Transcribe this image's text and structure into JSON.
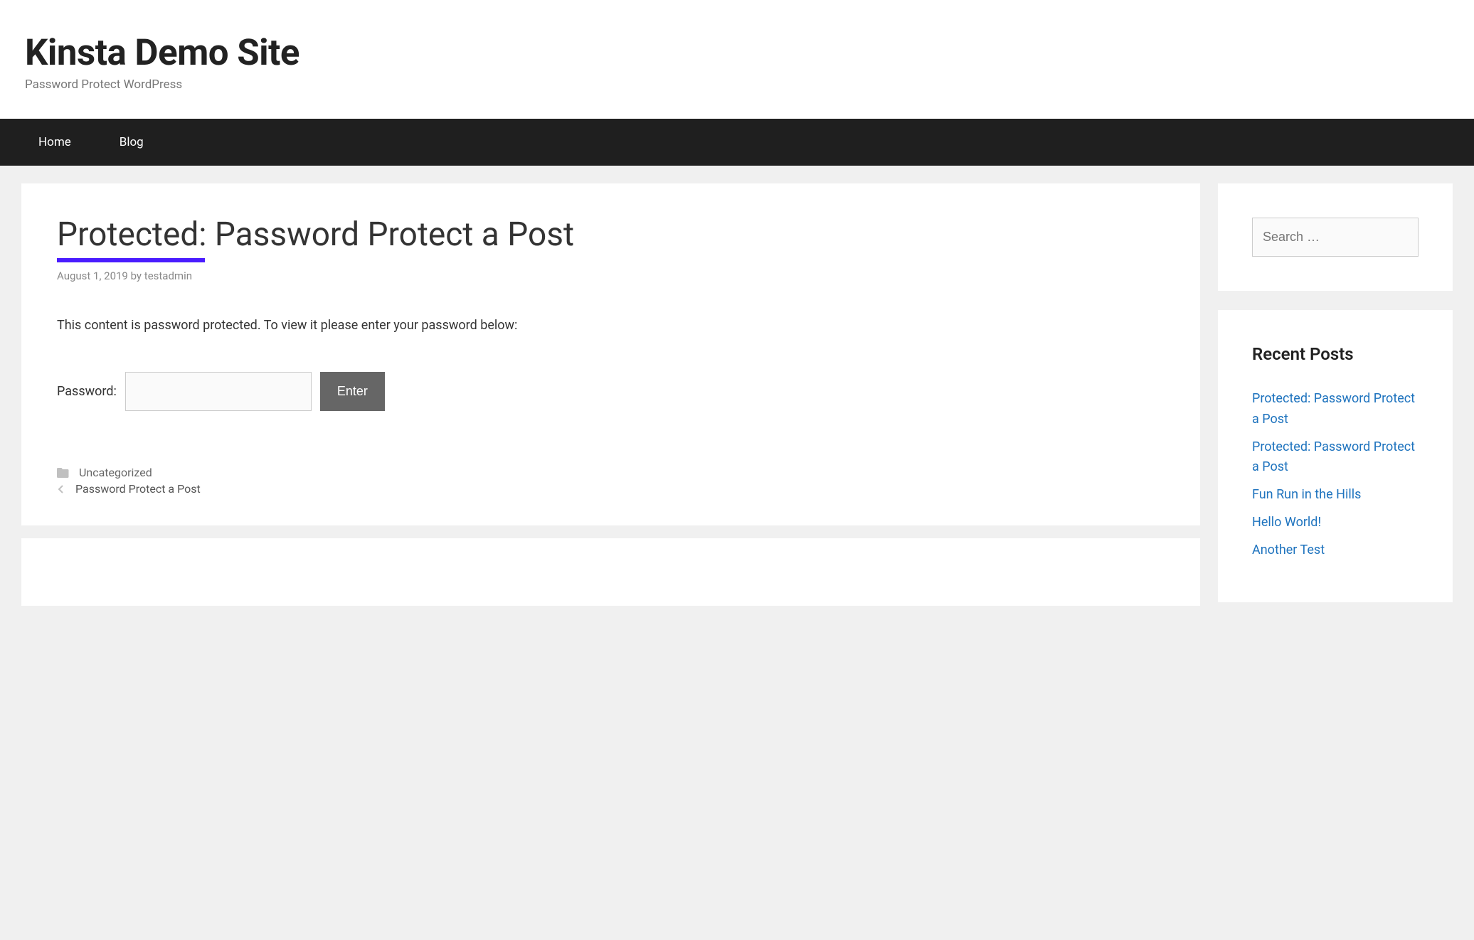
{
  "site": {
    "title": "Kinsta Demo Site",
    "tagline": "Password Protect WordPress"
  },
  "nav": {
    "items": [
      {
        "label": "Home"
      },
      {
        "label": "Blog"
      }
    ]
  },
  "post": {
    "title": "Protected: Password Protect a Post",
    "date": "August 1, 2019",
    "by_label": "by",
    "author": "testadmin",
    "protected_message": "This content is password protected. To view it please enter your password below:",
    "password_label": "Password:",
    "submit_label": "Enter",
    "category": "Uncategorized",
    "prev_nav": "Password Protect a Post"
  },
  "sidebar": {
    "search_placeholder": "Search …",
    "recent_title": "Recent Posts",
    "recent_posts": [
      {
        "title": "Protected: Password Protect a Post"
      },
      {
        "title": "Protected: Password Protect a Post"
      },
      {
        "title": "Fun Run in the Hills"
      },
      {
        "title": "Hello World!"
      },
      {
        "title": "Another Test"
      }
    ]
  }
}
